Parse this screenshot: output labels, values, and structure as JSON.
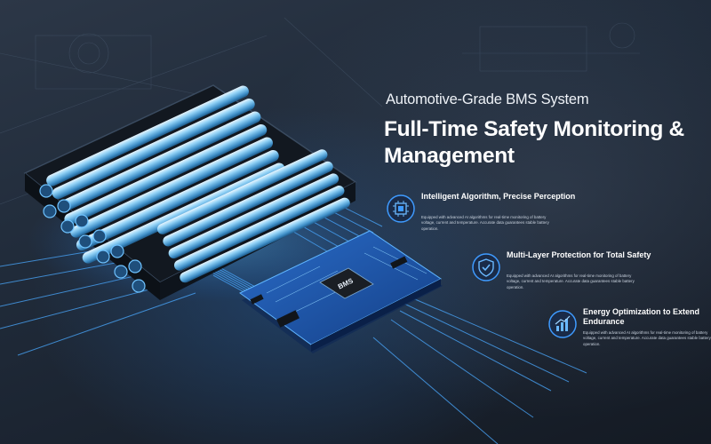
{
  "header": {
    "kicker": "Automotive-Grade BMS System",
    "headline": "Full-Time Safety Monitoring & Management"
  },
  "chip_label": "BMS",
  "accent_color": "#3f9bff",
  "features": [
    {
      "icon": "chip-icon",
      "title": "Intelligent Algorithm, Precise Perception",
      "description": "Equipped with advanced AI algorithms for real-time monitoring of battery voltage, current and temperature. Accurate data guarantees stable battery operation."
    },
    {
      "icon": "shield-check-icon",
      "title": "Multi-Layer Protection for Total Safety",
      "description": "Equipped with advanced AI algorithms for real-time monitoring of battery voltage, current and temperature. Accurate data guarantees stable battery operation."
    },
    {
      "icon": "bar-chart-icon",
      "title": "Energy Optimization to Extend Endurance",
      "description": "Equipped with advanced AI algorithms for real-time monitoring of battery voltage, current and temperature. Accurate data guarantees stable battery operation."
    }
  ]
}
